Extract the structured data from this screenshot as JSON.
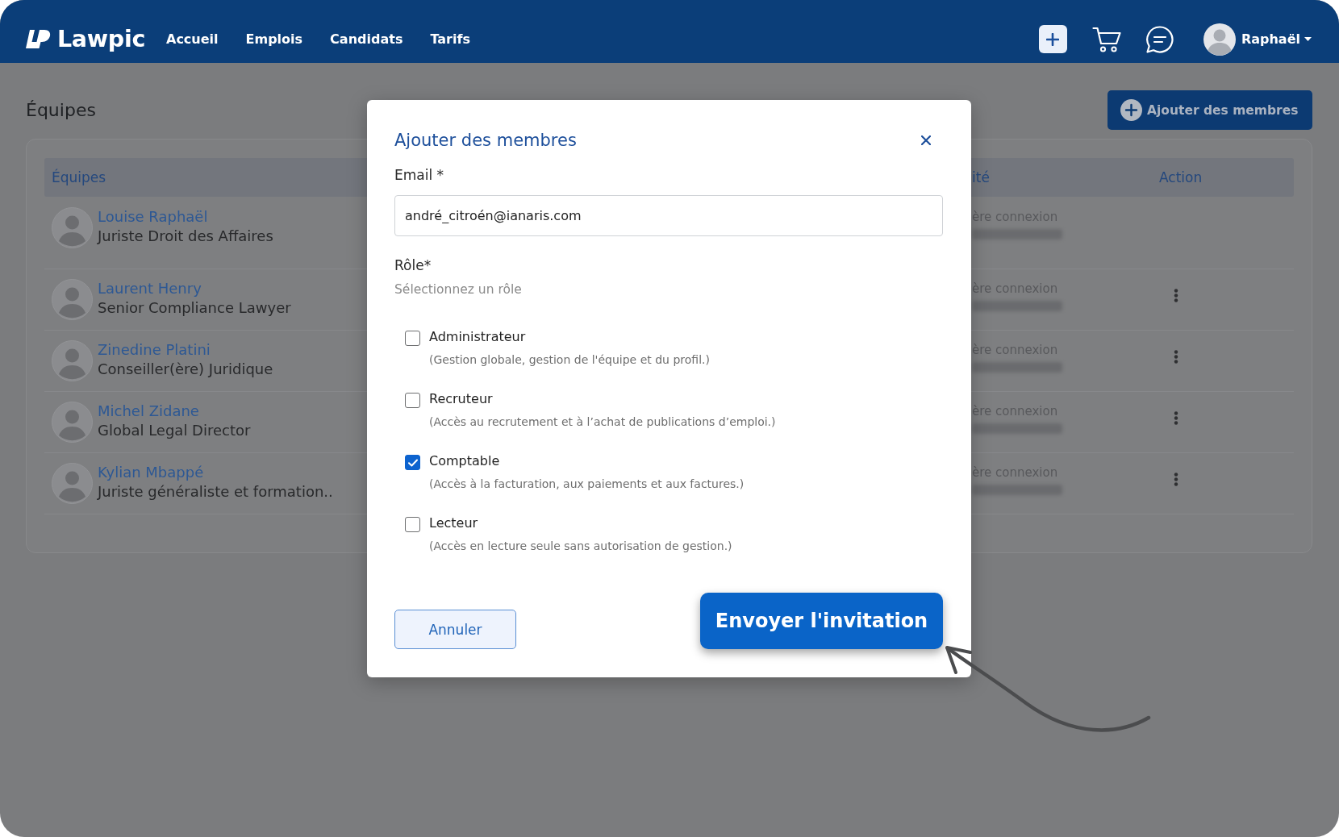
{
  "header": {
    "logo": "Lawpic",
    "nav": [
      {
        "label": "Accueil"
      },
      {
        "label": "Emplois"
      },
      {
        "label": "Candidats"
      },
      {
        "label": "Tarifs"
      }
    ],
    "user": {
      "name": "Raphaël"
    }
  },
  "page": {
    "title": "Équipes",
    "add_button": "Ajouter des membres"
  },
  "table": {
    "columns": [
      {
        "label": "Équipes"
      },
      {
        "label": "ité"
      },
      {
        "label": "Action"
      }
    ],
    "rows": [
      {
        "name": "Louise Raphaël",
        "role": "Juriste Droit des Affaires",
        "column_2": "ère connexion",
        "menu": false
      },
      {
        "name": "Laurent Henry",
        "role": "Senior Compliance Lawyer",
        "column_2": "ère connexion",
        "menu": true
      },
      {
        "name": "Zinedine Platini",
        "role": "Conseiller(ère) Juridique",
        "column_2": "ère connexion",
        "menu": true
      },
      {
        "name": "Michel Zidane",
        "role": "Global Legal Director",
        "column_2": "ère connexion",
        "menu": true
      },
      {
        "name": "Kylian Mbappé",
        "role": "Juriste généraliste et formation..",
        "column_2": "ère connexion",
        "menu": true
      }
    ]
  },
  "modal": {
    "title": "Ajouter des membres",
    "email_label": "Email *",
    "email_value": "andré_citroén@ianaris.com",
    "role_label": "Rôle*",
    "role_hint": "Sélectionnez un rôle",
    "roles": [
      {
        "label": "Administrateur",
        "description": "(Gestion globale, gestion de l'équipe et du profil.)",
        "checked": false
      },
      {
        "label": "Recruteur",
        "description": "(Accès au recrutement et à l’achat de publications d’emploi.)",
        "checked": false
      },
      {
        "label": "Comptable",
        "description": "(Accès à la facturation, aux paiements et aux factures.)",
        "checked": true
      },
      {
        "label": "Lecteur",
        "description": "(Accès en lecture seule sans autorisation de gestion.)",
        "checked": false
      }
    ],
    "cancel": "Annuler",
    "submit": "Envoyer l'invitation"
  }
}
